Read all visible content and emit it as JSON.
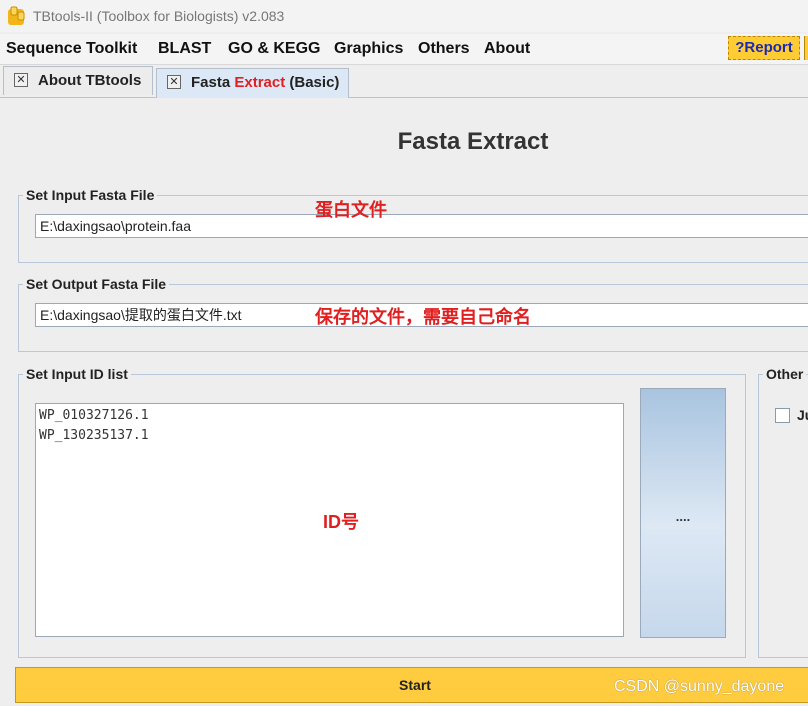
{
  "window": {
    "title": "TBtools-II (Toolbox for Biologists) v2.083",
    "icon": "tbtools-logo-icon"
  },
  "menu": {
    "items": [
      "Sequence Toolkit",
      "BLAST",
      "GO & KEGG",
      "Graphics",
      "Others",
      "About"
    ],
    "report_label": "?Report"
  },
  "tabs": {
    "about": {
      "label": "About TBtools"
    },
    "fasta": {
      "label_prefix": "Fasta ",
      "label_highlight": "Extract",
      "label_suffix": " (Basic)"
    }
  },
  "page": {
    "title": "Fasta Extract"
  },
  "input_fasta": {
    "legend": "Set Input Fasta File",
    "value": "E:\\daxingsao\\protein.faa",
    "annotation": "蛋白文件"
  },
  "output_fasta": {
    "legend": "Set Output Fasta File",
    "value": "E:\\daxingsao\\提取的蛋白文件.txt",
    "annotation": "保存的文件，需要自己命名"
  },
  "id_list": {
    "legend": "Set Input ID list",
    "lines": [
      "WP_010327126.1",
      "WP_130235137.1"
    ],
    "annotation": "ID号",
    "browse_label": "...."
  },
  "other": {
    "legend": "Other",
    "checkbox_label": "Ju"
  },
  "actions": {
    "start_label": "Start"
  },
  "watermark": "CSDN @sunny_dayone",
  "colors": {
    "accent_yellow": "#ffcc40",
    "annotation_red": "#e02020",
    "report_text": "#1a2ab5",
    "tab_active": "#dce8f6"
  }
}
